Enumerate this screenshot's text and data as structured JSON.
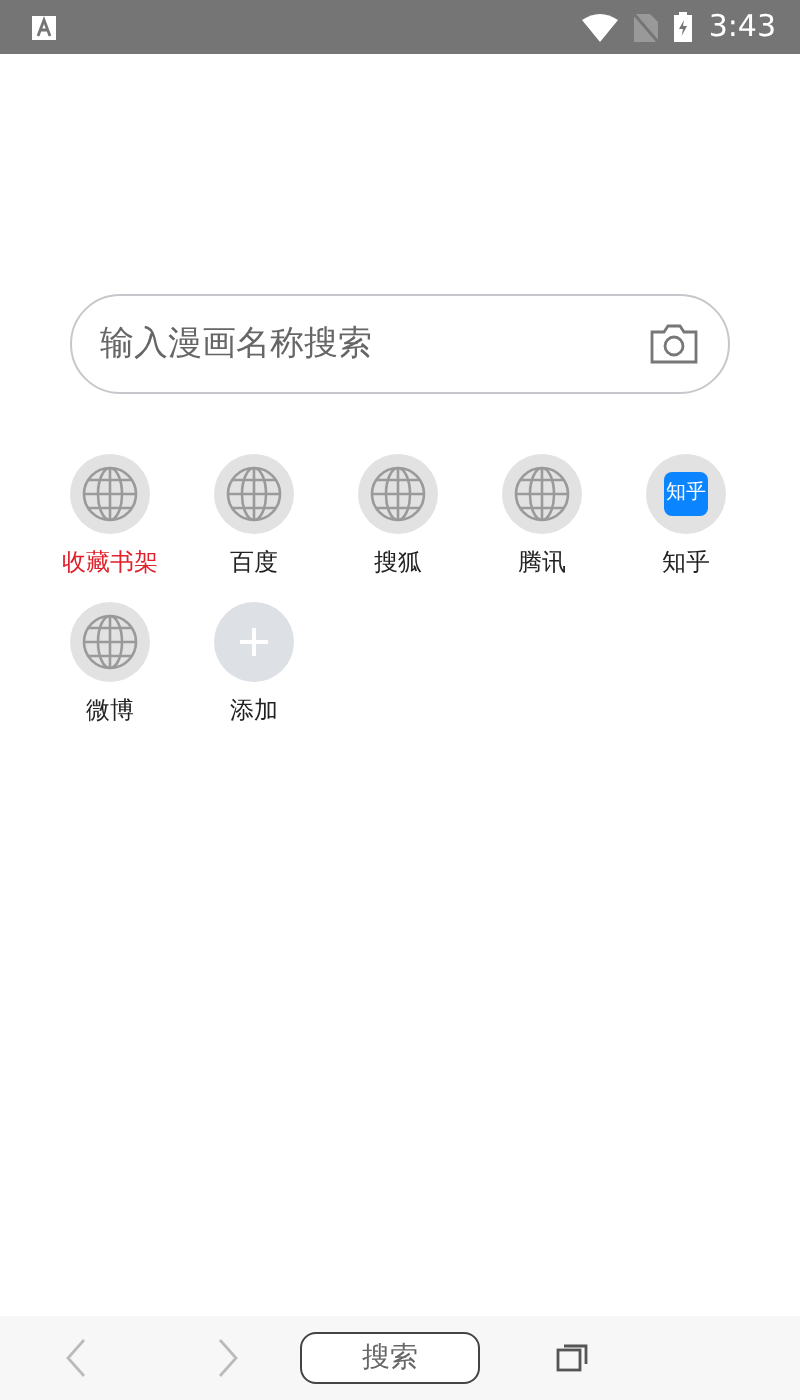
{
  "status_bar": {
    "time": "3:43"
  },
  "search": {
    "placeholder": "输入漫画名称搜索"
  },
  "shortcuts": [
    {
      "label": "收藏书架",
      "kind": "globe",
      "highlighted": true
    },
    {
      "label": "百度",
      "kind": "globe",
      "highlighted": false
    },
    {
      "label": "搜狐",
      "kind": "globe",
      "highlighted": false
    },
    {
      "label": "腾讯",
      "kind": "globe",
      "highlighted": false
    },
    {
      "label": "知乎",
      "kind": "logo",
      "logo_text": "知乎",
      "highlighted": false
    },
    {
      "label": "微博",
      "kind": "globe",
      "highlighted": false
    },
    {
      "label": "添加",
      "kind": "add",
      "highlighted": false
    }
  ],
  "bottom_bar": {
    "search_button": "搜索"
  }
}
